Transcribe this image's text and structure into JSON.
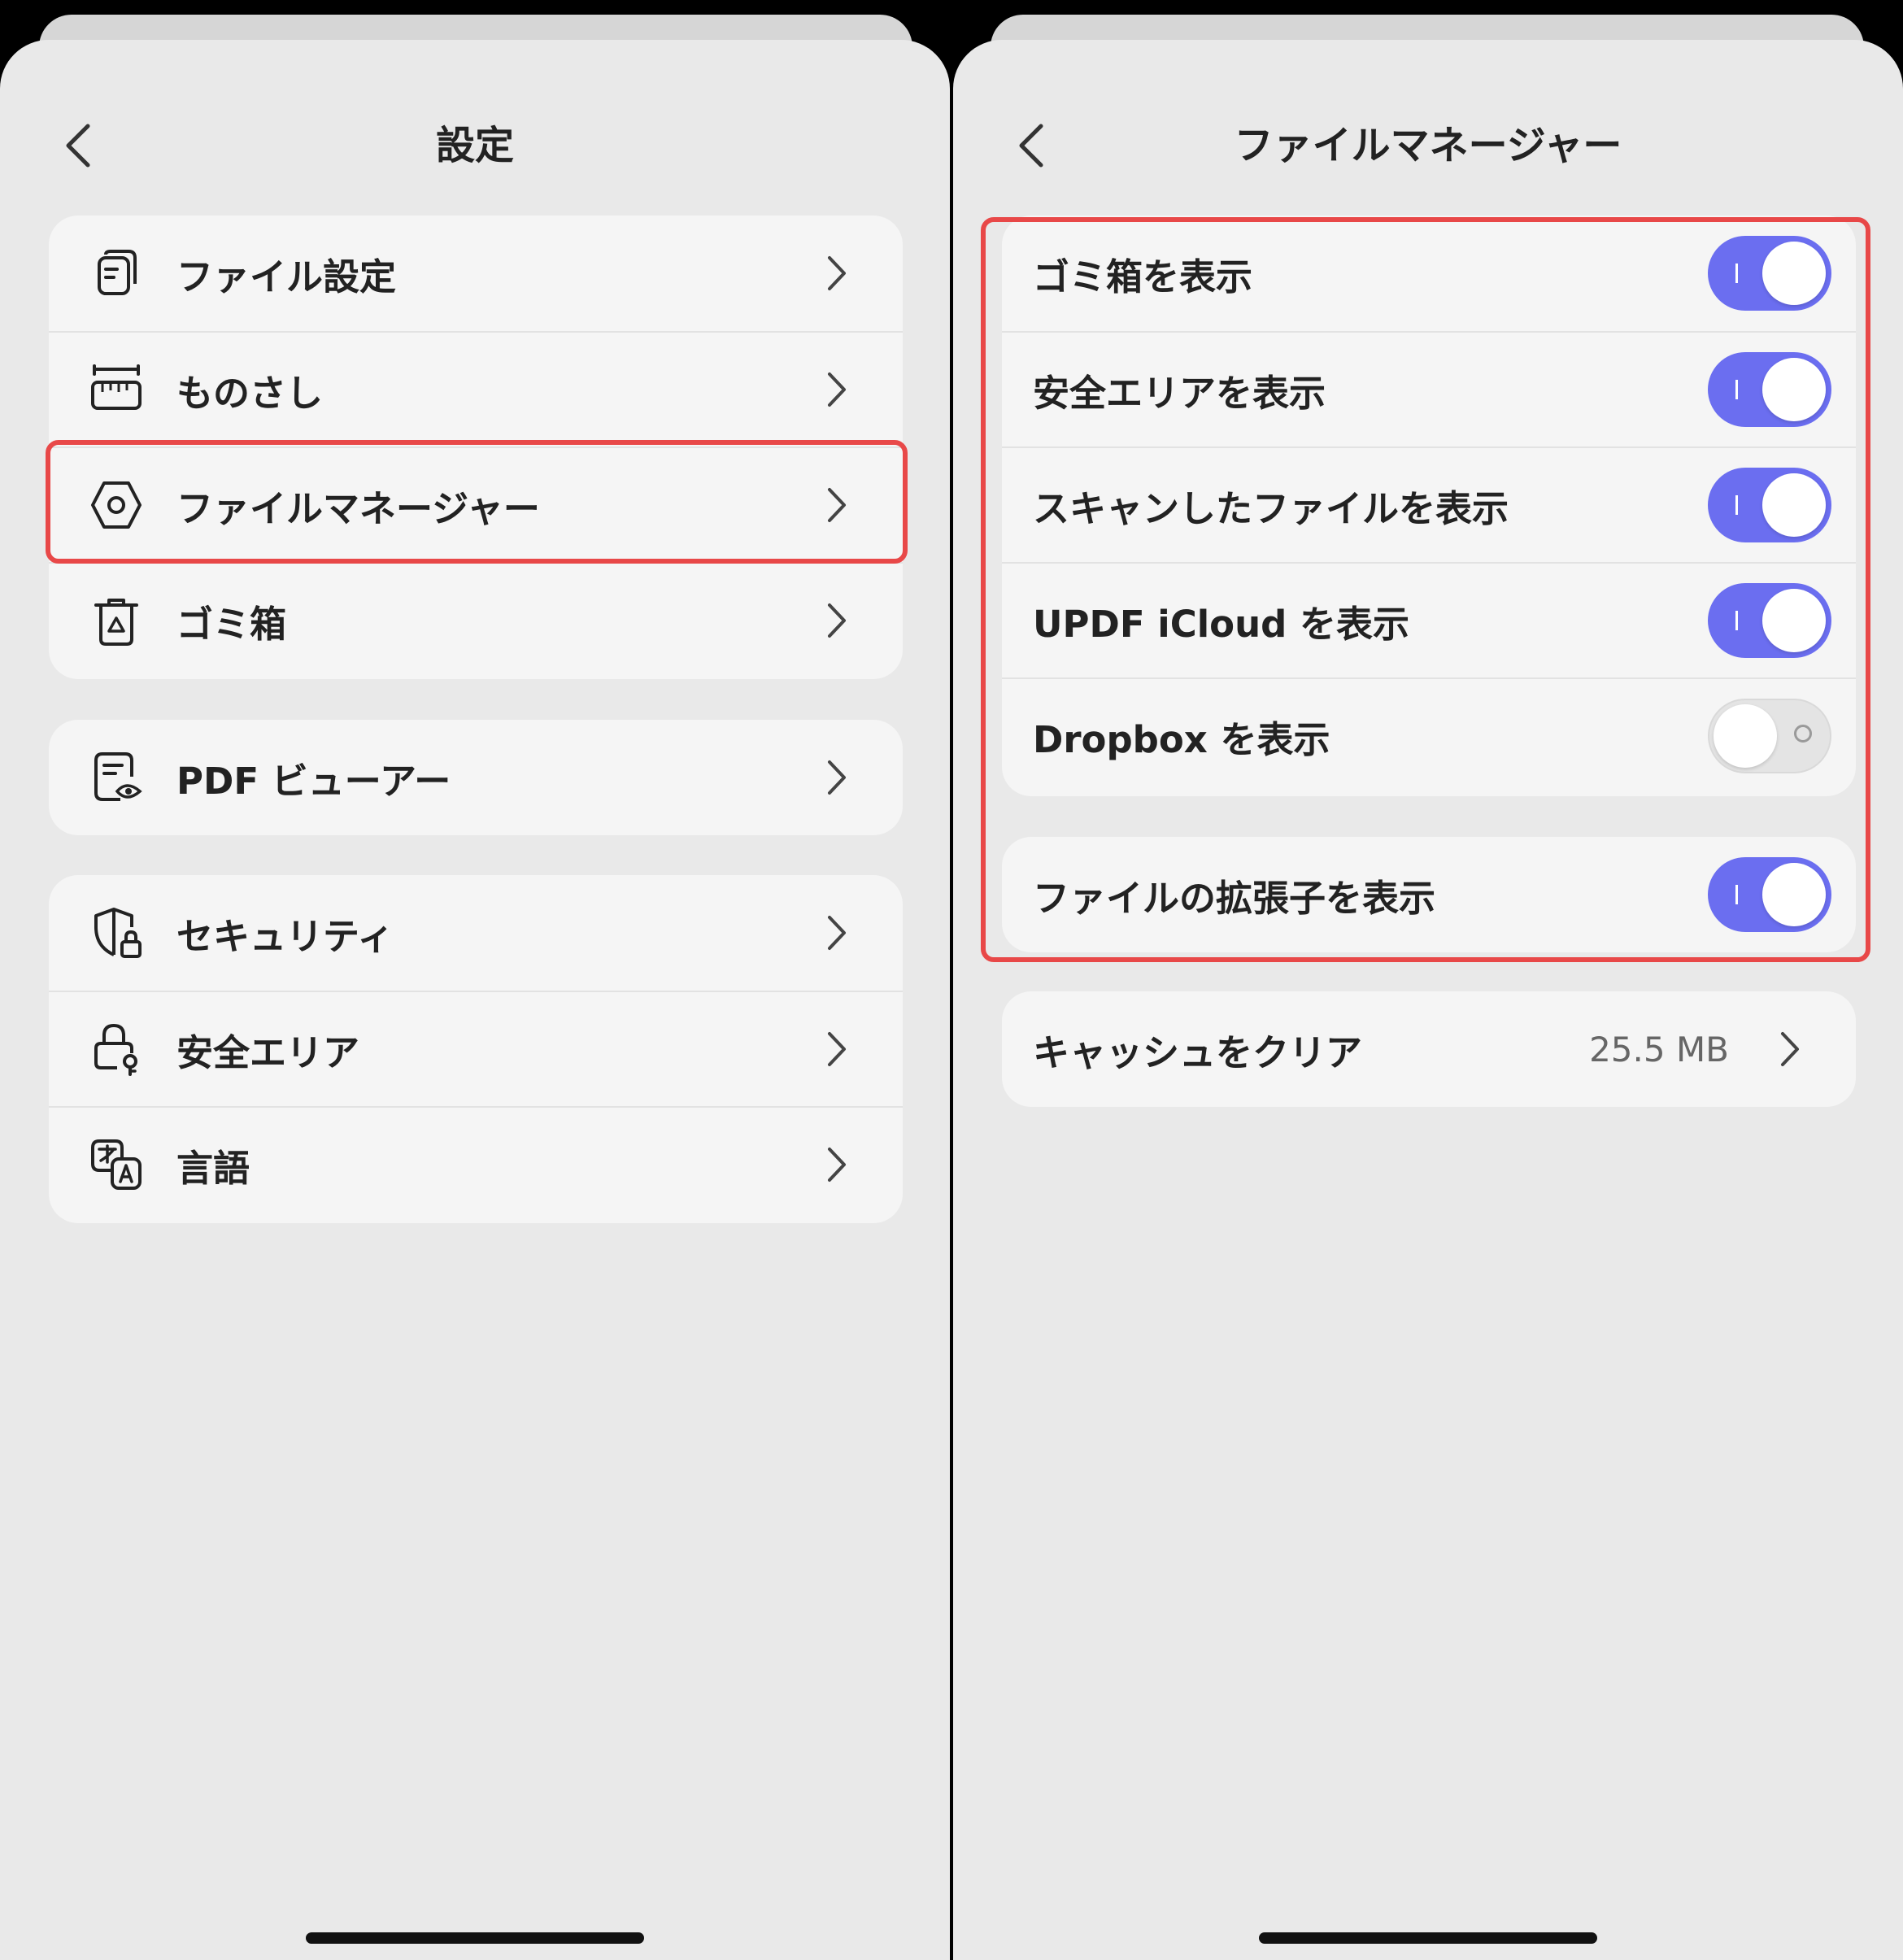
{
  "left_screen": {
    "title": "設定",
    "groups": [
      [
        {
          "label": "ファイル設定",
          "icon": "file-settings-icon"
        },
        {
          "label": "ものさし",
          "icon": "ruler-icon"
        },
        {
          "label": "ファイルマネージャー",
          "icon": "hexagon-gear-icon",
          "highlighted": true
        },
        {
          "label": "ゴミ箱",
          "icon": "trash-icon"
        }
      ],
      [
        {
          "label": "PDF ビューアー",
          "icon": "document-eye-icon"
        }
      ],
      [
        {
          "label": "セキュリティ",
          "icon": "shield-lock-icon"
        },
        {
          "label": "安全エリア",
          "icon": "lock-key-icon"
        },
        {
          "label": "言語",
          "icon": "translate-icon"
        }
      ]
    ]
  },
  "right_screen": {
    "title": "ファイルマネージャー",
    "toggle_group": [
      {
        "label": "ゴミ箱を表示",
        "on": true
      },
      {
        "label": "安全エリアを表示",
        "on": true
      },
      {
        "label": "スキャンしたファイルを表示",
        "on": true
      },
      {
        "label": "UPDF iCloud を表示",
        "on": true
      },
      {
        "label": "Dropbox を表示",
        "on": false
      }
    ],
    "toggle_group_2": [
      {
        "label": "ファイルの拡張子を表示",
        "on": true
      }
    ],
    "cache": {
      "label": "キャッシュをクリア",
      "value": "25.5 MB"
    }
  },
  "colors": {
    "accent": "#6b6ef0",
    "highlight": "#e84848",
    "background": "#e9e9e9",
    "card": "#f5f5f5"
  }
}
